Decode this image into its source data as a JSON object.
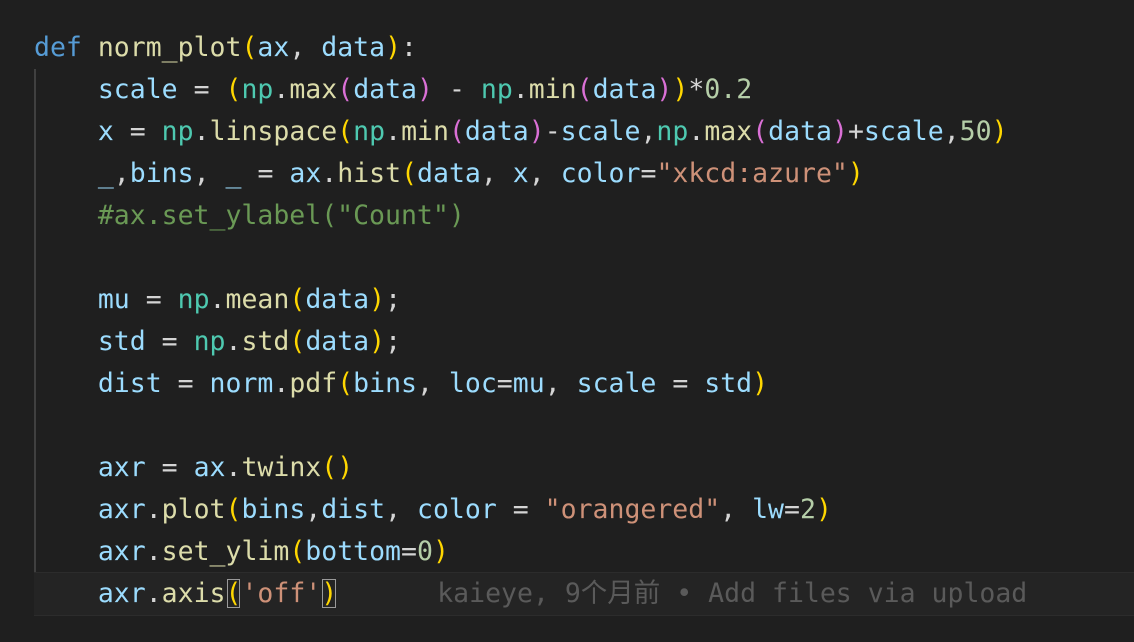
{
  "editor": {
    "lines": [
      [
        {
          "t": "def",
          "c": "kw"
        },
        {
          "t": " ",
          "c": "op"
        },
        {
          "t": "norm_plot",
          "c": "fn"
        },
        {
          "t": "(",
          "c": "p1"
        },
        {
          "t": "ax",
          "c": "var"
        },
        {
          "t": ", ",
          "c": "op"
        },
        {
          "t": "data",
          "c": "var"
        },
        {
          "t": ")",
          "c": "p1"
        },
        {
          "t": ":",
          "c": "op"
        }
      ],
      [
        {
          "t": "    ",
          "c": "op"
        },
        {
          "t": "scale",
          "c": "var"
        },
        {
          "t": " = ",
          "c": "op"
        },
        {
          "t": "(",
          "c": "p1"
        },
        {
          "t": "np",
          "c": "mod"
        },
        {
          "t": ".",
          "c": "op"
        },
        {
          "t": "max",
          "c": "fn"
        },
        {
          "t": "(",
          "c": "p2"
        },
        {
          "t": "data",
          "c": "var"
        },
        {
          "t": ")",
          "c": "p2"
        },
        {
          "t": " - ",
          "c": "op"
        },
        {
          "t": "np",
          "c": "mod"
        },
        {
          "t": ".",
          "c": "op"
        },
        {
          "t": "min",
          "c": "fn"
        },
        {
          "t": "(",
          "c": "p2"
        },
        {
          "t": "data",
          "c": "var"
        },
        {
          "t": ")",
          "c": "p2"
        },
        {
          "t": ")",
          "c": "p1"
        },
        {
          "t": "*",
          "c": "op"
        },
        {
          "t": "0.2",
          "c": "num"
        }
      ],
      [
        {
          "t": "    ",
          "c": "op"
        },
        {
          "t": "x",
          "c": "var"
        },
        {
          "t": " = ",
          "c": "op"
        },
        {
          "t": "np",
          "c": "mod"
        },
        {
          "t": ".",
          "c": "op"
        },
        {
          "t": "linspace",
          "c": "fn"
        },
        {
          "t": "(",
          "c": "p1"
        },
        {
          "t": "np",
          "c": "mod"
        },
        {
          "t": ".",
          "c": "op"
        },
        {
          "t": "min",
          "c": "fn"
        },
        {
          "t": "(",
          "c": "p2"
        },
        {
          "t": "data",
          "c": "var"
        },
        {
          "t": ")",
          "c": "p2"
        },
        {
          "t": "-",
          "c": "op"
        },
        {
          "t": "scale",
          "c": "var"
        },
        {
          "t": ",",
          "c": "op"
        },
        {
          "t": "np",
          "c": "mod"
        },
        {
          "t": ".",
          "c": "op"
        },
        {
          "t": "max",
          "c": "fn"
        },
        {
          "t": "(",
          "c": "p2"
        },
        {
          "t": "data",
          "c": "var"
        },
        {
          "t": ")",
          "c": "p2"
        },
        {
          "t": "+",
          "c": "op"
        },
        {
          "t": "scale",
          "c": "var"
        },
        {
          "t": ",",
          "c": "op"
        },
        {
          "t": "50",
          "c": "num"
        },
        {
          "t": ")",
          "c": "p1"
        }
      ],
      [
        {
          "t": "    ",
          "c": "op"
        },
        {
          "t": "_",
          "c": "var"
        },
        {
          "t": ",",
          "c": "op"
        },
        {
          "t": "bins",
          "c": "var"
        },
        {
          "t": ", ",
          "c": "op"
        },
        {
          "t": "_",
          "c": "var"
        },
        {
          "t": " = ",
          "c": "op"
        },
        {
          "t": "ax",
          "c": "var"
        },
        {
          "t": ".",
          "c": "op"
        },
        {
          "t": "hist",
          "c": "fn"
        },
        {
          "t": "(",
          "c": "p1"
        },
        {
          "t": "data",
          "c": "var"
        },
        {
          "t": ", ",
          "c": "op"
        },
        {
          "t": "x",
          "c": "var"
        },
        {
          "t": ", ",
          "c": "op"
        },
        {
          "t": "color",
          "c": "var"
        },
        {
          "t": "=",
          "c": "op"
        },
        {
          "t": "\"xkcd:azure\"",
          "c": "str"
        },
        {
          "t": ")",
          "c": "p1"
        }
      ],
      [
        {
          "t": "    ",
          "c": "op"
        },
        {
          "t": "#ax.set_ylabel(\"Count\")",
          "c": "cmt"
        }
      ],
      [],
      [
        {
          "t": "    ",
          "c": "op"
        },
        {
          "t": "mu",
          "c": "var"
        },
        {
          "t": " = ",
          "c": "op"
        },
        {
          "t": "np",
          "c": "mod"
        },
        {
          "t": ".",
          "c": "op"
        },
        {
          "t": "mean",
          "c": "fn"
        },
        {
          "t": "(",
          "c": "p1"
        },
        {
          "t": "data",
          "c": "var"
        },
        {
          "t": ")",
          "c": "p1"
        },
        {
          "t": ";",
          "c": "op"
        }
      ],
      [
        {
          "t": "    ",
          "c": "op"
        },
        {
          "t": "std",
          "c": "var"
        },
        {
          "t": " = ",
          "c": "op"
        },
        {
          "t": "np",
          "c": "mod"
        },
        {
          "t": ".",
          "c": "op"
        },
        {
          "t": "std",
          "c": "fn"
        },
        {
          "t": "(",
          "c": "p1"
        },
        {
          "t": "data",
          "c": "var"
        },
        {
          "t": ")",
          "c": "p1"
        },
        {
          "t": ";",
          "c": "op"
        }
      ],
      [
        {
          "t": "    ",
          "c": "op"
        },
        {
          "t": "dist",
          "c": "var"
        },
        {
          "t": " = ",
          "c": "op"
        },
        {
          "t": "norm",
          "c": "var"
        },
        {
          "t": ".",
          "c": "op"
        },
        {
          "t": "pdf",
          "c": "fn"
        },
        {
          "t": "(",
          "c": "p1"
        },
        {
          "t": "bins",
          "c": "var"
        },
        {
          "t": ", ",
          "c": "op"
        },
        {
          "t": "loc",
          "c": "var"
        },
        {
          "t": "=",
          "c": "op"
        },
        {
          "t": "mu",
          "c": "var"
        },
        {
          "t": ", ",
          "c": "op"
        },
        {
          "t": "scale",
          "c": "var"
        },
        {
          "t": " = ",
          "c": "op"
        },
        {
          "t": "std",
          "c": "var"
        },
        {
          "t": ")",
          "c": "p1"
        }
      ],
      [],
      [
        {
          "t": "    ",
          "c": "op"
        },
        {
          "t": "axr",
          "c": "var"
        },
        {
          "t": " = ",
          "c": "op"
        },
        {
          "t": "ax",
          "c": "var"
        },
        {
          "t": ".",
          "c": "op"
        },
        {
          "t": "twinx",
          "c": "fn"
        },
        {
          "t": "(",
          "c": "p1"
        },
        {
          "t": ")",
          "c": "p1"
        }
      ],
      [
        {
          "t": "    ",
          "c": "op"
        },
        {
          "t": "axr",
          "c": "var"
        },
        {
          "t": ".",
          "c": "op"
        },
        {
          "t": "plot",
          "c": "fn"
        },
        {
          "t": "(",
          "c": "p1"
        },
        {
          "t": "bins",
          "c": "var"
        },
        {
          "t": ",",
          "c": "op"
        },
        {
          "t": "dist",
          "c": "var"
        },
        {
          "t": ", ",
          "c": "op"
        },
        {
          "t": "color",
          "c": "var"
        },
        {
          "t": " = ",
          "c": "op"
        },
        {
          "t": "\"orangered\"",
          "c": "str"
        },
        {
          "t": ", ",
          "c": "op"
        },
        {
          "t": "lw",
          "c": "var"
        },
        {
          "t": "=",
          "c": "op"
        },
        {
          "t": "2",
          "c": "num"
        },
        {
          "t": ")",
          "c": "p1"
        }
      ],
      [
        {
          "t": "    ",
          "c": "op"
        },
        {
          "t": "axr",
          "c": "var"
        },
        {
          "t": ".",
          "c": "op"
        },
        {
          "t": "set_ylim",
          "c": "fn"
        },
        {
          "t": "(",
          "c": "p1"
        },
        {
          "t": "bottom",
          "c": "var"
        },
        {
          "t": "=",
          "c": "op"
        },
        {
          "t": "0",
          "c": "num"
        },
        {
          "t": ")",
          "c": "p1"
        }
      ],
      [
        {
          "t": "    ",
          "c": "op"
        },
        {
          "t": "axr",
          "c": "var"
        },
        {
          "t": ".",
          "c": "op"
        },
        {
          "t": "axis",
          "c": "fn"
        },
        {
          "t": "(",
          "c": "p1",
          "m": true
        },
        {
          "t": "'off'",
          "c": "str"
        },
        {
          "t": ")",
          "c": "p1",
          "m": true
        }
      ]
    ],
    "current_line": 13,
    "blame": "kaieye, 9个月前 • Add files via upload"
  }
}
